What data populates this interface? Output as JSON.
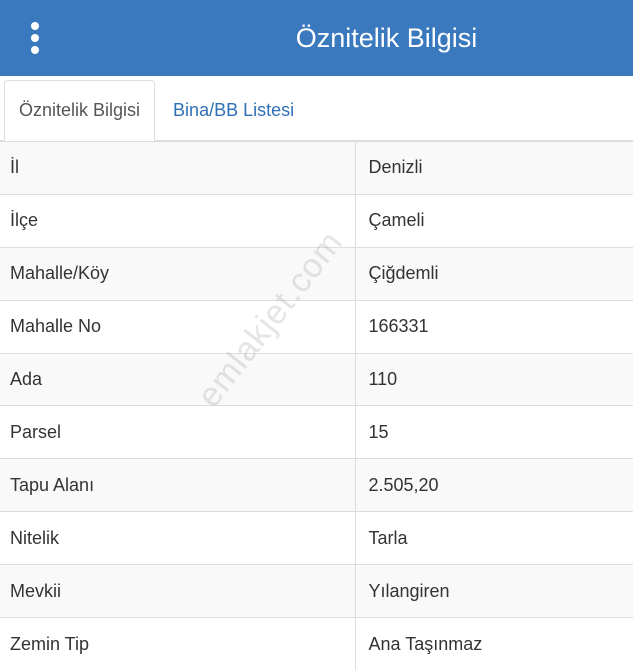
{
  "header": {
    "title": "Öznitelik Bilgisi",
    "menu_icon": "vertical-dots-icon",
    "color": "#3a79be"
  },
  "tabs": [
    {
      "label": "Öznitelik Bilgisi",
      "active": true
    },
    {
      "label": "Bina/BB Listesi",
      "active": false
    }
  ],
  "rows": [
    {
      "label": "İl",
      "value": "Denizli"
    },
    {
      "label": "İlçe",
      "value": "Çameli"
    },
    {
      "label": "Mahalle/Köy",
      "value": "Çiğdemli"
    },
    {
      "label": "Mahalle No",
      "value": "166331"
    },
    {
      "label": "Ada",
      "value": "110"
    },
    {
      "label": "Parsel",
      "value": "15"
    },
    {
      "label": "Tapu Alanı",
      "value": "2.505,20"
    },
    {
      "label": "Nitelik",
      "value": "Tarla"
    },
    {
      "label": "Mevkii",
      "value": "Yılangiren"
    },
    {
      "label": "Zemin Tip",
      "value": "Ana Taşınmaz"
    }
  ],
  "watermark": "emlakjet.com"
}
